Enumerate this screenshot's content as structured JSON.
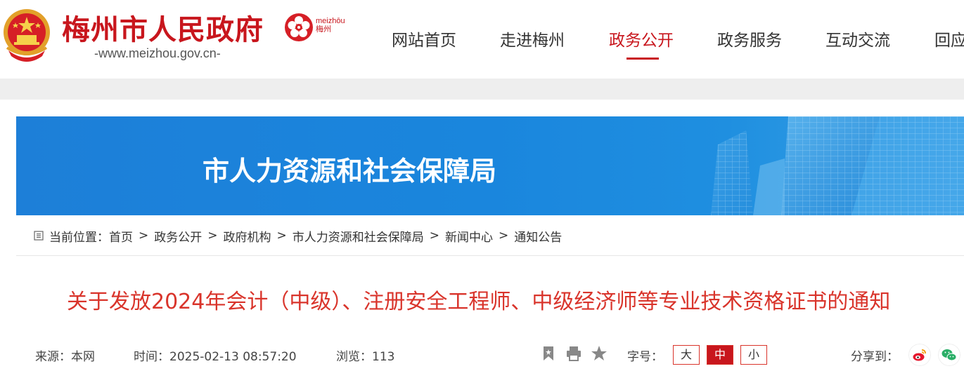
{
  "header": {
    "site_title": "梅州市人民政府",
    "site_url": "-www.meizhou.gov.cn-",
    "city_logo_text_1": "meizhōu",
    "city_logo_text_2": "梅州",
    "nav": [
      {
        "label": "网站首页",
        "active": false
      },
      {
        "label": "走进梅州",
        "active": false
      },
      {
        "label": "政务公开",
        "active": true
      },
      {
        "label": "政务服务",
        "active": false
      },
      {
        "label": "互动交流",
        "active": false
      },
      {
        "label": "回应",
        "active": false
      }
    ]
  },
  "banner": {
    "title": "市人力资源和社会保障局"
  },
  "breadcrumb": {
    "prefix": "当前位置：",
    "items": [
      "首页",
      "政务公开",
      "政府机构",
      "市人力资源和社会保障局",
      "新闻中心",
      "通知公告"
    ],
    "separator": ">"
  },
  "article": {
    "title": "关于发放2024年会计（中级）、注册安全工程师、中级经济师等专业技术资格证书的通知",
    "source": "来源：本网",
    "time": "时间：2025-02-13 08:57:20",
    "views": "浏览：113",
    "font_size_label": "字号：",
    "font_sizes": [
      {
        "label": "大",
        "active": false
      },
      {
        "label": "中",
        "active": true
      },
      {
        "label": "小",
        "active": false
      }
    ],
    "share_label": "分享到："
  },
  "colors": {
    "brand_red": "#c8161d",
    "title_red": "#d9342b",
    "banner_blue": "#1a86dd",
    "weibo_red": "#e6162d",
    "wechat_green": "#2aae67"
  },
  "icons": [
    "national-emblem-icon",
    "plum-blossom-logo-icon",
    "breadcrumb-icon",
    "bookmark-icon",
    "print-icon",
    "star-icon",
    "weibo-icon",
    "wechat-icon"
  ]
}
